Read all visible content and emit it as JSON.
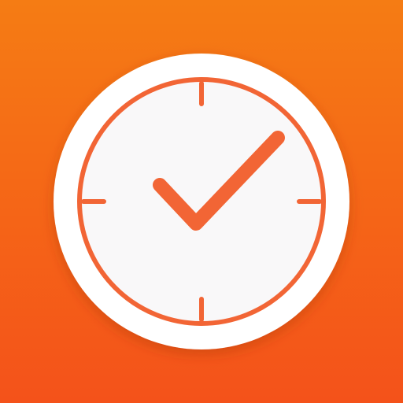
{
  "icon": {
    "name": "clock-check-icon",
    "background_top": "#F57C14",
    "background_bottom": "#F4521A",
    "badge_color": "#FFFFFF",
    "face_color": "#F9F8F9",
    "stroke_color": "#F26535"
  }
}
